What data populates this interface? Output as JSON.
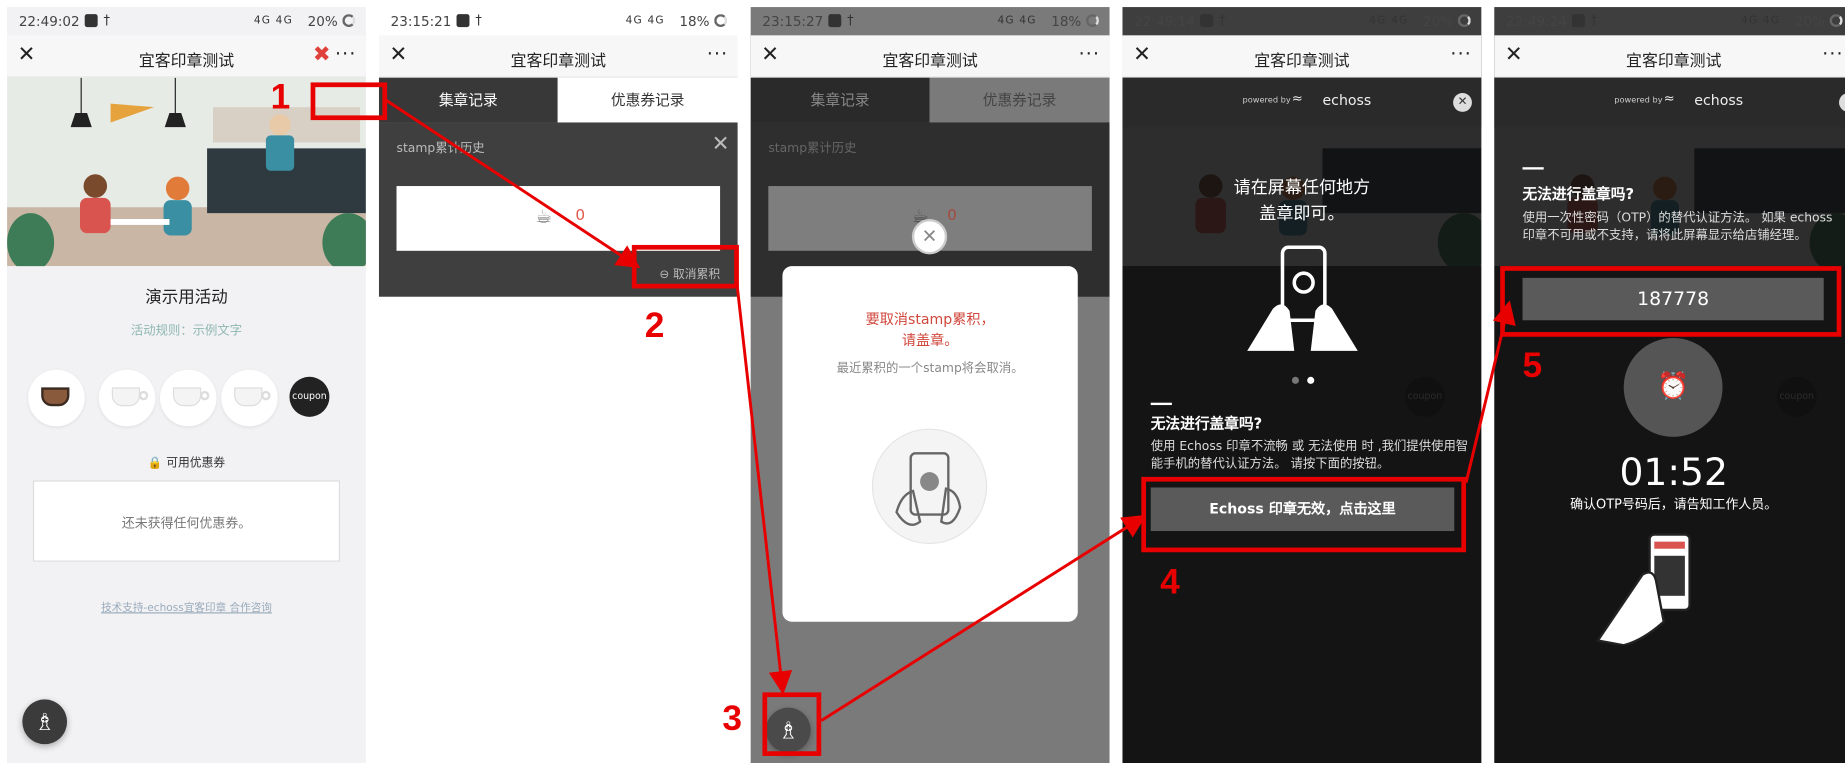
{
  "panels": [
    {
      "status": {
        "time": "22:49:02",
        "signal": "4G 4G",
        "battery": "20%"
      },
      "nav": {
        "title": "宜客印章测试",
        "more": "···"
      },
      "campaign_title": "演示用活动",
      "rules": "活动规则：示例文字",
      "coupon_text": "coupon",
      "coupon_section": "可用优惠券",
      "empty_coupon": "还未获得任何优惠券。",
      "footer_link": "技术支持-echoss宜客印章 合作咨询"
    },
    {
      "status": {
        "time": "23:15:21",
        "signal": "4G 4G",
        "battery": "18%"
      },
      "nav": {
        "title": "宜客印章测试",
        "more": "···"
      },
      "tabs": [
        "集章记录",
        "优惠券记录"
      ],
      "history_title": "stamp累计历史",
      "stamp_count": "0",
      "cancel_button": "取消累积"
    },
    {
      "status": {
        "time": "23:15:27",
        "signal": "4G 4G",
        "battery": "18%"
      },
      "nav": {
        "title": "宜客印章测试",
        "more": "···"
      },
      "tabs": [
        "集章记录",
        "优惠券记录"
      ],
      "history_title": "stamp累计历史",
      "stamp_count": "0",
      "modal_line1": "要取消stamp累积，",
      "modal_line2": "请盖章。",
      "modal_desc": "最近累积的一个stamp将会取消。"
    },
    {
      "status": {
        "time": "22:49:14",
        "signal": "4G 4G",
        "battery": "20%"
      },
      "nav": {
        "title": "宜客印章测试",
        "more": "···"
      },
      "powered_by": "powered by",
      "brand": "echoss",
      "instruction_line1": "请在屏幕任何地方",
      "instruction_line2": "盖章即可。",
      "fallback_title": "无法进行盖章吗?",
      "fallback_desc": "使用 Echoss 印章不流畅 或 无法使用 时 ,我们提供使用智能手机的替代认证方法。 请按下面的按钮。",
      "fallback_button": "Echoss 印章无效，点击这里",
      "bg_coupon_text": "coupon"
    },
    {
      "status": {
        "time": "22:49:24",
        "signal": "4G 4G",
        "battery": "20%"
      },
      "nav": {
        "title": "宜客印章测试",
        "more": "···"
      },
      "powered_by": "powered by",
      "brand": "echoss",
      "otp_title": "无法进行盖章吗?",
      "otp_desc": "使用一次性密码（OTP）的替代认证方法。 如果 echoss 印章不可用或不支持，请将此屏幕显示给店铺经理。",
      "otp_code": "187778",
      "timer": "01:52",
      "otp_note": "确认OTP号码后，请告知工作人员。",
      "bg_coupon_text": "coupon"
    }
  ],
  "steps": [
    "1",
    "2",
    "3",
    "4",
    "5"
  ],
  "colors": {
    "accent_red": "#e80000",
    "dark_overlay": "#2b2b2b",
    "modal_text_red": "#d0473c"
  }
}
